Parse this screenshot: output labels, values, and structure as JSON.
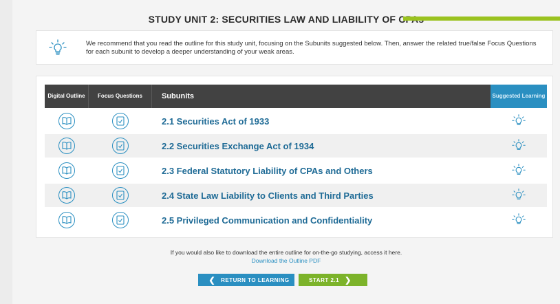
{
  "unit": {
    "title": "STUDY UNIT 2: SECURITIES LAW AND LIABILITY OF CPAs"
  },
  "recommendation": {
    "icon": "lightbulb-icon",
    "text": "We recommend that you read the outline for this study unit, focusing on the Subunits suggested below. Then, answer the related true/false Focus Questions for each subunit to develop a deeper understanding of your weak areas."
  },
  "table": {
    "headers": {
      "digital_outline": "Digital Outline",
      "focus_questions": "Focus Questions",
      "subunits": "Subunits",
      "suggested_learning": "Suggested Learning"
    },
    "rows": [
      {
        "label": "2.1 Securities Act of 1933",
        "suggested": true
      },
      {
        "label": "2.2 Securities Exchange Act of 1934",
        "suggested": true
      },
      {
        "label": "2.3 Federal Statutory Liability of CPAs and Others",
        "suggested": true
      },
      {
        "label": "2.4 State Law Liability to Clients and Third Parties",
        "suggested": true
      },
      {
        "label": "2.5 Privileged Communication and Confidentiality",
        "suggested": true
      }
    ]
  },
  "footer": {
    "text": "If you would also like to download the entire outline for on-the-go studying, access it here.",
    "link": "Download the Outline PDF"
  },
  "buttons": {
    "back": "RETURN TO LEARNING",
    "start": "START 2.1"
  },
  "colors": {
    "accent_blue": "#2a8fc1",
    "accent_green": "#7cb32a",
    "header_dark": "#424242"
  }
}
